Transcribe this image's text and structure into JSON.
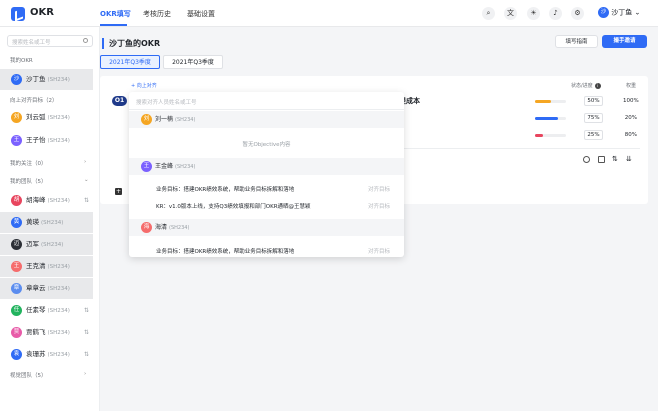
{
  "app": {
    "brand": "OKR"
  },
  "nav": {
    "items": [
      "OKR填写",
      "考核历史",
      "基础设置"
    ],
    "active": 0
  },
  "top_icons": [
    "search-icon",
    "translate-icon",
    "sun-icon",
    "bell-icon",
    "gear-icon"
  ],
  "user": {
    "avatar": "沙",
    "name": "沙丁鱼",
    "caret": "⌄"
  },
  "sidebar": {
    "search_placeholder": "搜索姓名或工号",
    "my_okr_label": "我的OKR",
    "me": {
      "avatar": "沙",
      "name": "沙丁鱼",
      "code": "(SH234)"
    },
    "upward_label": "向上对齐目标（2）",
    "upward": [
      {
        "avatar": "刘",
        "name": "刘云弧",
        "code": "(SH234)",
        "color": "#f5a623"
      },
      {
        "avatar": "王",
        "name": "王子怡",
        "code": "(SH234)",
        "color": "#7b61ff"
      }
    ],
    "follow_label": "我的关注（0）",
    "team_label": "我的团队（5）",
    "team": [
      {
        "avatar": "胡",
        "name": "胡海峰",
        "code": "(SH234)",
        "color": "#e8455e"
      },
      {
        "avatar": "黄",
        "name": "黄瑛",
        "code": "(SH234)",
        "color": "#2f6bf5"
      },
      {
        "avatar": "迈",
        "name": "迈军",
        "code": "(SH234)",
        "color": "#2b2f36"
      },
      {
        "avatar": "王",
        "name": "王克清",
        "code": "(SH234)",
        "color": "#f56c6c"
      },
      {
        "avatar": "章",
        "name": "章章云",
        "code": "(SH234)",
        "color": "#5b8def"
      },
      {
        "avatar": "任",
        "name": "任素琴",
        "code": "(SH234)",
        "color": "#22b35e"
      },
      {
        "avatar": "贾",
        "name": "贾鹤飞",
        "code": "(SH234)",
        "color": "#e85ba8"
      },
      {
        "avatar": "袁",
        "name": "袁珊苏",
        "code": "(SH234)",
        "color": "#2f6bf5"
      }
    ],
    "vision_label": "视觉团队（5）",
    "link_glyph": "⇅",
    "chevron": "›"
  },
  "main": {
    "title": "沙丁鱼的OKR",
    "guide_button": "填写指南",
    "invite_button": "撮手邀请",
    "quarters": [
      "2021年Q3季度",
      "2021年Q3季度"
    ],
    "align_link": "+ 向上对齐",
    "objective_badge": "O1",
    "objective_text": "提成本",
    "status_header": "状态/进度",
    "weight_header": "权重",
    "krs": [
      {
        "progress": 0.5,
        "pct": "50%",
        "weight": "100%",
        "color": "#f5a623"
      },
      {
        "progress": 0.75,
        "pct": "75%",
        "weight": "20%",
        "color": "#2f6bf5"
      },
      {
        "progress": 0.25,
        "pct": "25%",
        "weight": "80%",
        "color": "#e8455e"
      }
    ]
  },
  "dropdown": {
    "placeholder": "搜索对齐人员姓名或工号",
    "groups": [
      {
        "avatar": "刘",
        "name": "刘一楠",
        "code": "(SH234)",
        "color": "#f5a623"
      },
      {
        "avatar": "王",
        "name": "王金峰",
        "code": "(SH234)",
        "color": "#7b61ff"
      },
      {
        "avatar": "海",
        "name": "海清",
        "code": "(SH234)",
        "color": "#f56c6c"
      }
    ],
    "empty_text": "暂无Objective内容",
    "rows": [
      {
        "text": "业务目标：搭建OKR绩效系统，帮助业务目标拆解和落地",
        "action": "对齐目标"
      },
      {
        "text": "KR：v1.0版本上线，支持Q3绩效填报和部门OKR通晒@王慧颖",
        "action": "对齐目标"
      },
      {
        "text": "业务目标：搭建OKR绩效系统，帮助业务目标拆解和落地",
        "action": "对齐目标"
      }
    ]
  }
}
